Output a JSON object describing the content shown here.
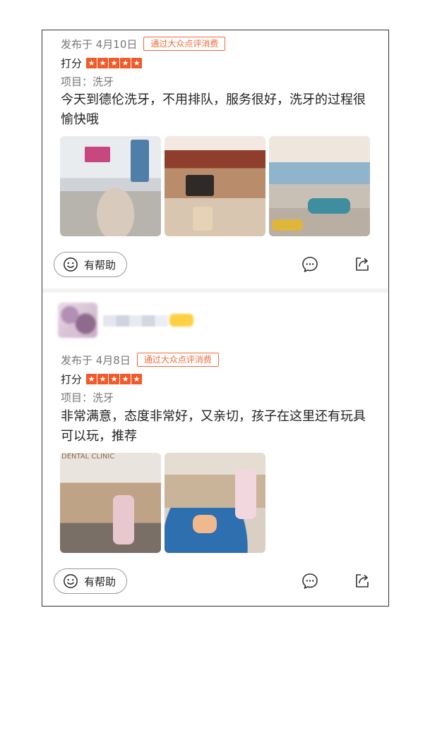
{
  "review1": {
    "date": "发布于 4月10日",
    "consume_tag": "通过大众点评消费",
    "score_label": "打分",
    "stars": 5,
    "project": "项目：洗牙",
    "content": "今天到德伦洗牙，不用排队，服务很好，洗牙的过程很愉快哦",
    "photo_count": 3,
    "helpful_label": "有帮助"
  },
  "review2": {
    "date": "发布于 4月8日",
    "consume_tag": "通过大众点评消费",
    "score_label": "打分",
    "stars": 5,
    "project": "项目：洗牙",
    "content": "非常满意，态度非常好，又亲切，孩子在这里还有玩具可以玩，推荐",
    "photo_count": 2,
    "helpful_label": "有帮助"
  },
  "icons": {
    "star": "star-icon",
    "helpful": "smile-icon",
    "comment": "comment-icon",
    "share": "share-icon"
  },
  "colors": {
    "accent": "#f15a2a",
    "tag": "#ee6b3b",
    "muted": "#777777"
  }
}
